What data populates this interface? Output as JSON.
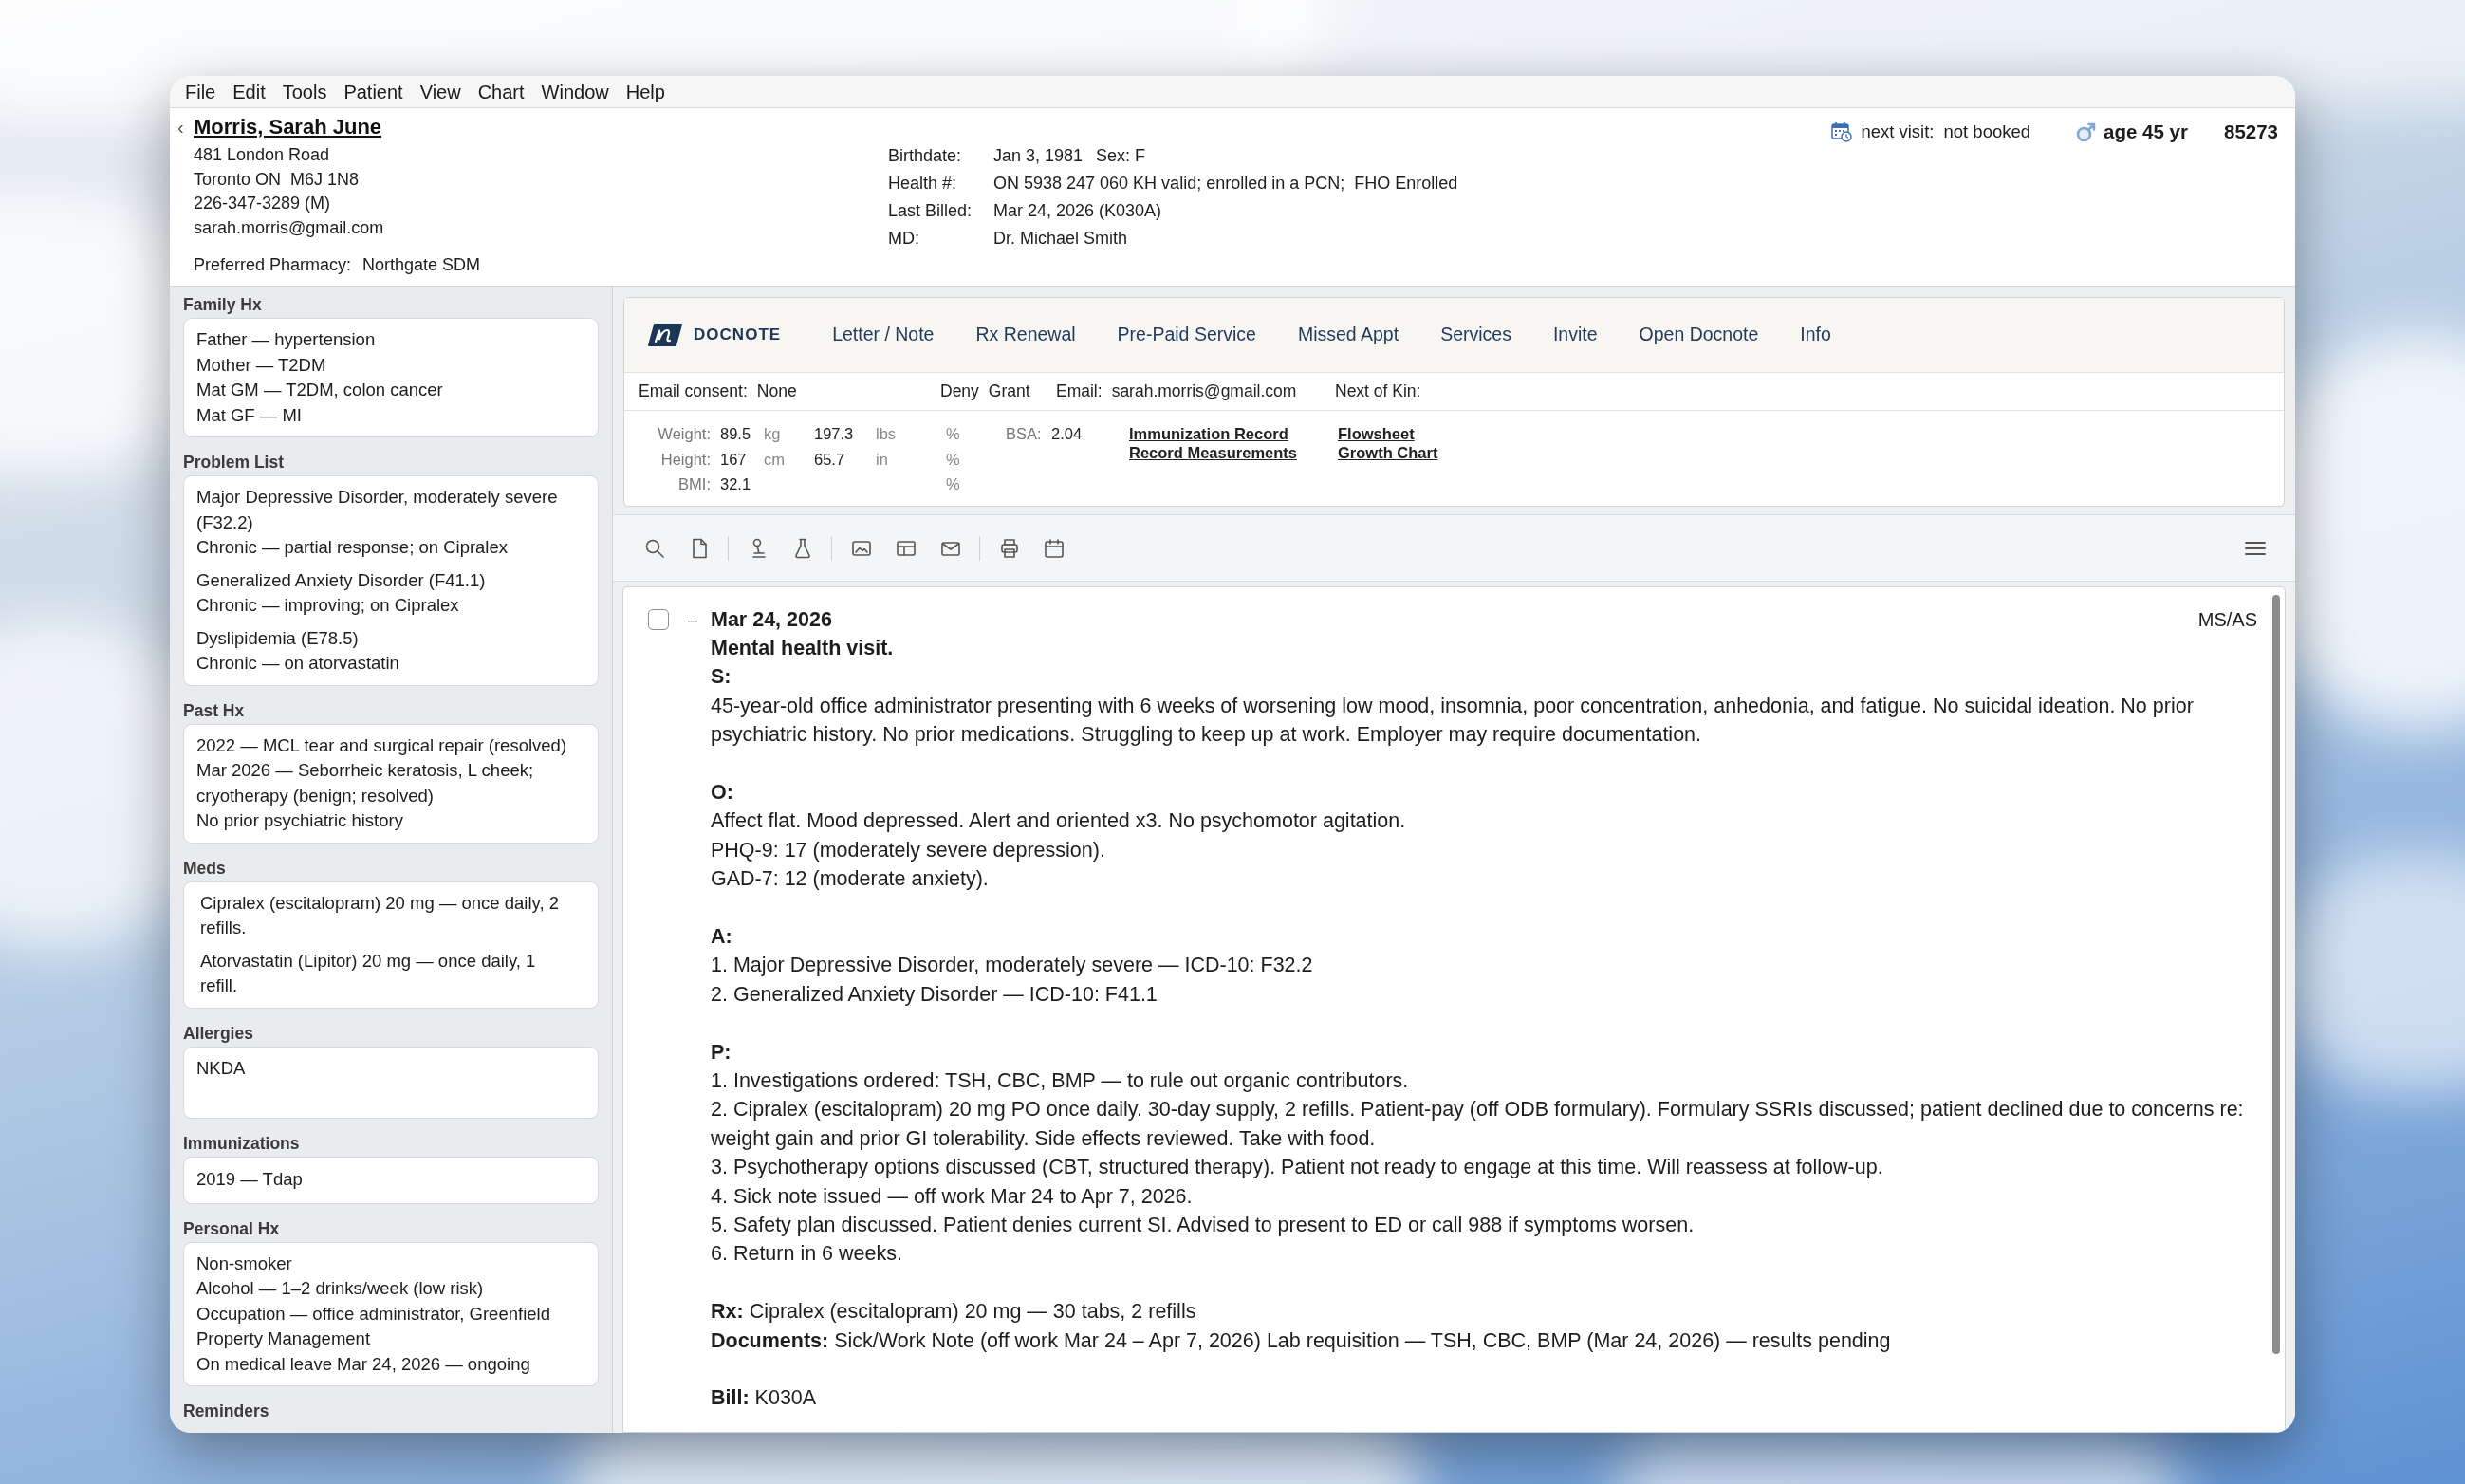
{
  "menu": [
    "File",
    "Edit",
    "Tools",
    "Patient",
    "View",
    "Chart",
    "Window",
    "Help"
  ],
  "patient": {
    "back_symbol": "‹",
    "name": "Morris, Sarah June",
    "contact_lines": [
      "481 London Road",
      "Toronto ON  M6J 1N8",
      "226-347-3289 (M)",
      "sarah.morris@gmail.com"
    ],
    "pharmacy": {
      "label": "Preferred Pharmacy:",
      "value": "Northgate SDM"
    },
    "details": [
      {
        "label": "Birthdate:",
        "value": "Jan 3, 1981",
        "extra": "Sex: F"
      },
      {
        "label": "Health #:",
        "value": "ON 5938 247 060 KH valid; enrolled in a PCN;  FHO Enrolled"
      },
      {
        "label": "Last Billed:",
        "value": "Mar 24, 2026 (K030A)"
      },
      {
        "label": "MD:",
        "value": "Dr. Michael Smith"
      }
    ],
    "next_visit": {
      "label": "next visit:",
      "value": "not booked"
    },
    "age": "age 45 yr",
    "chart_number": "85273"
  },
  "sidebar": {
    "sections": [
      {
        "title": "Family Hx",
        "kind": "list",
        "entries": [
          [
            "Father — hypertension",
            "Mother — T2DM",
            "Mat GM — T2DM, colon cancer",
            "Mat GF — MI"
          ]
        ]
      },
      {
        "title": "Problem List",
        "kind": "list",
        "entries": [
          [
            "Major Depressive Disorder, moderately severe (F32.2)",
            "Chronic — partial response; on Cipralex"
          ],
          [
            "Generalized Anxiety Disorder (F41.1)",
            "Chronic — improving; on Cipralex"
          ],
          [
            "Dyslipidemia (E78.5)",
            "Chronic — on atorvastatin"
          ]
        ]
      },
      {
        "title": "Past Hx",
        "kind": "list",
        "entries": [
          [
            "2022 — MCL tear and surgical repair (resolved)",
            "Mar 2026 — Seborrheic keratosis, L cheek; cryotherapy (benign; resolved)",
            "No prior psychiatric history"
          ]
        ]
      },
      {
        "title": "Meds",
        "kind": "indented",
        "entries": [
          [
            "Cipralex (escitalopram) 20 mg — once daily, 2 refills."
          ],
          [
            "Atorvastatin (Lipitor) 20 mg — once daily, 1 refill."
          ]
        ]
      },
      {
        "title": "Allergies",
        "kind": "box",
        "entries": [
          [
            "NKDA"
          ]
        ]
      },
      {
        "title": "Immunizations",
        "kind": "list",
        "entries": [
          [
            "2019 — Tdap"
          ]
        ]
      },
      {
        "title": "Personal Hx",
        "kind": "list",
        "entries": [
          [
            "Non-smoker",
            "Alcohol — 1–2 drinks/week (low risk)",
            "Occupation — office administrator, Greenfield Property Management",
            "On medical leave Mar 24, 2026 — ongoing"
          ]
        ]
      },
      {
        "title": "Reminders"
      }
    ]
  },
  "docnote": {
    "brand": "DOCNOTE",
    "nav": [
      "Letter / Note",
      "Rx Renewal",
      "Pre-Paid Service",
      "Missed Appt",
      "Services",
      "Invite",
      "Open Docnote",
      "Info"
    ],
    "consent": {
      "label": "Email consent:",
      "value": "None",
      "options": [
        "Deny",
        "Grant"
      ]
    },
    "email": {
      "label": "Email:",
      "value": "sarah.morris@gmail.com"
    },
    "next_of_kin": {
      "label": "Next of Kin:"
    },
    "vitals": [
      {
        "label": "Weight:",
        "value": "89.5",
        "unit": "kg",
        "alt_value": "197.3",
        "alt_unit": "lbs",
        "percentile": "%"
      },
      {
        "label": "Height:",
        "value": "167",
        "unit": "cm",
        "alt_value": "65.7",
        "alt_unit": "in",
        "percentile": "%"
      },
      {
        "label": "BMI:",
        "value": "32.1",
        "percentile": "%"
      }
    ],
    "bsa": {
      "label": "BSA:",
      "value": "2.04"
    },
    "links": [
      [
        "Immunization Record",
        "Record Measurements"
      ],
      [
        "Flowsheet",
        "Growth Chart"
      ]
    ]
  },
  "note": {
    "checked": false,
    "collapse_symbol": "–",
    "date": "Mar 24, 2026",
    "initials": "MS/AS",
    "title": "Mental health visit.",
    "sections": [
      {
        "heading": "S:",
        "lines": [
          "45-year-old office administrator presenting with 6 weeks of worsening low mood, insomnia, poor concentration, anhedonia, and fatigue. No suicidal ideation. No prior psychiatric history. No prior medications. Struggling to keep up at work. Employer may require documentation."
        ]
      },
      {
        "heading": "O:",
        "lines": [
          "Affect flat. Mood depressed. Alert and oriented x3. No psychomotor agitation.",
          "PHQ-9: 17 (moderately severe depression).",
          "GAD-7: 12 (moderate anxiety)."
        ]
      },
      {
        "heading": "A:",
        "lines": [
          "1. Major Depressive Disorder, moderately severe — ICD-10: F32.2",
          "2. Generalized Anxiety Disorder — ICD-10: F41.1"
        ]
      },
      {
        "heading": "P:",
        "lines": [
          "1. Investigations ordered: TSH, CBC, BMP — to rule out organic contributors.",
          "2. Cipralex (escitalopram) 20 mg PO once daily. 30-day supply, 2 refills. Patient-pay (off ODB formulary). Formulary SSRIs discussed; patient declined due to concerns re: weight gain and prior GI tolerability. Side effects reviewed. Take with food.",
          "3. Psychotherapy options discussed (CBT, structured therapy). Patient not ready to engage at this time. Will reassess at follow-up.",
          "4. Sick note issued — off work Mar 24 to Apr 7, 2026.",
          "5. Safety plan discussed. Patient denies current SI. Advised to present to ED or call 988 if symptoms worsen.",
          "6. Return in 6 weeks."
        ]
      }
    ],
    "blocks": [
      [
        "**Rx:** Cipralex (escitalopram) 20 mg — 30 tabs, 2 refills",
        "**Documents:** Sick/Work Note (off work Mar 24 – Apr 7, 2026) Lab requisition — TSH, CBC, BMP (Mar 24, 2026) — results pending"
      ],
      [
        "**Bill:** K030A"
      ]
    ]
  }
}
